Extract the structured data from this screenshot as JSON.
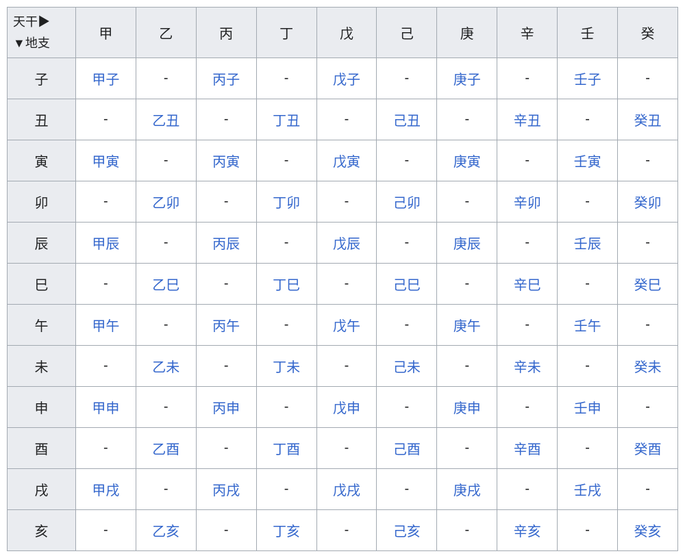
{
  "corner": {
    "line1": "天干▶",
    "line2": "▼地支"
  },
  "stems": [
    "甲",
    "乙",
    "丙",
    "丁",
    "戊",
    "己",
    "庚",
    "辛",
    "壬",
    "癸"
  ],
  "branches": [
    "子",
    "丑",
    "寅",
    "卯",
    "辰",
    "巳",
    "午",
    "未",
    "申",
    "酉",
    "戌",
    "亥"
  ],
  "rows": [
    [
      "甲子",
      "-",
      "丙子",
      "-",
      "戊子",
      "-",
      "庚子",
      "-",
      "壬子",
      "-"
    ],
    [
      "-",
      "乙丑",
      "-",
      "丁丑",
      "-",
      "己丑",
      "-",
      "辛丑",
      "-",
      "癸丑"
    ],
    [
      "甲寅",
      "-",
      "丙寅",
      "-",
      "戊寅",
      "-",
      "庚寅",
      "-",
      "壬寅",
      "-"
    ],
    [
      "-",
      "乙卯",
      "-",
      "丁卯",
      "-",
      "己卯",
      "-",
      "辛卯",
      "-",
      "癸卯"
    ],
    [
      "甲辰",
      "-",
      "丙辰",
      "-",
      "戊辰",
      "-",
      "庚辰",
      "-",
      "壬辰",
      "-"
    ],
    [
      "-",
      "乙巳",
      "-",
      "丁巳",
      "-",
      "己巳",
      "-",
      "辛巳",
      "-",
      "癸巳"
    ],
    [
      "甲午",
      "-",
      "丙午",
      "-",
      "戊午",
      "-",
      "庚午",
      "-",
      "壬午",
      "-"
    ],
    [
      "-",
      "乙未",
      "-",
      "丁未",
      "-",
      "己未",
      "-",
      "辛未",
      "-",
      "癸未"
    ],
    [
      "甲申",
      "-",
      "丙申",
      "-",
      "戊申",
      "-",
      "庚申",
      "-",
      "壬申",
      "-"
    ],
    [
      "-",
      "乙酉",
      "-",
      "丁酉",
      "-",
      "己酉",
      "-",
      "辛酉",
      "-",
      "癸酉"
    ],
    [
      "甲戌",
      "-",
      "丙戌",
      "-",
      "戊戌",
      "-",
      "庚戌",
      "-",
      "壬戌",
      "-"
    ],
    [
      "-",
      "乙亥",
      "-",
      "丁亥",
      "-",
      "己亥",
      "-",
      "辛亥",
      "-",
      "癸亥"
    ]
  ]
}
